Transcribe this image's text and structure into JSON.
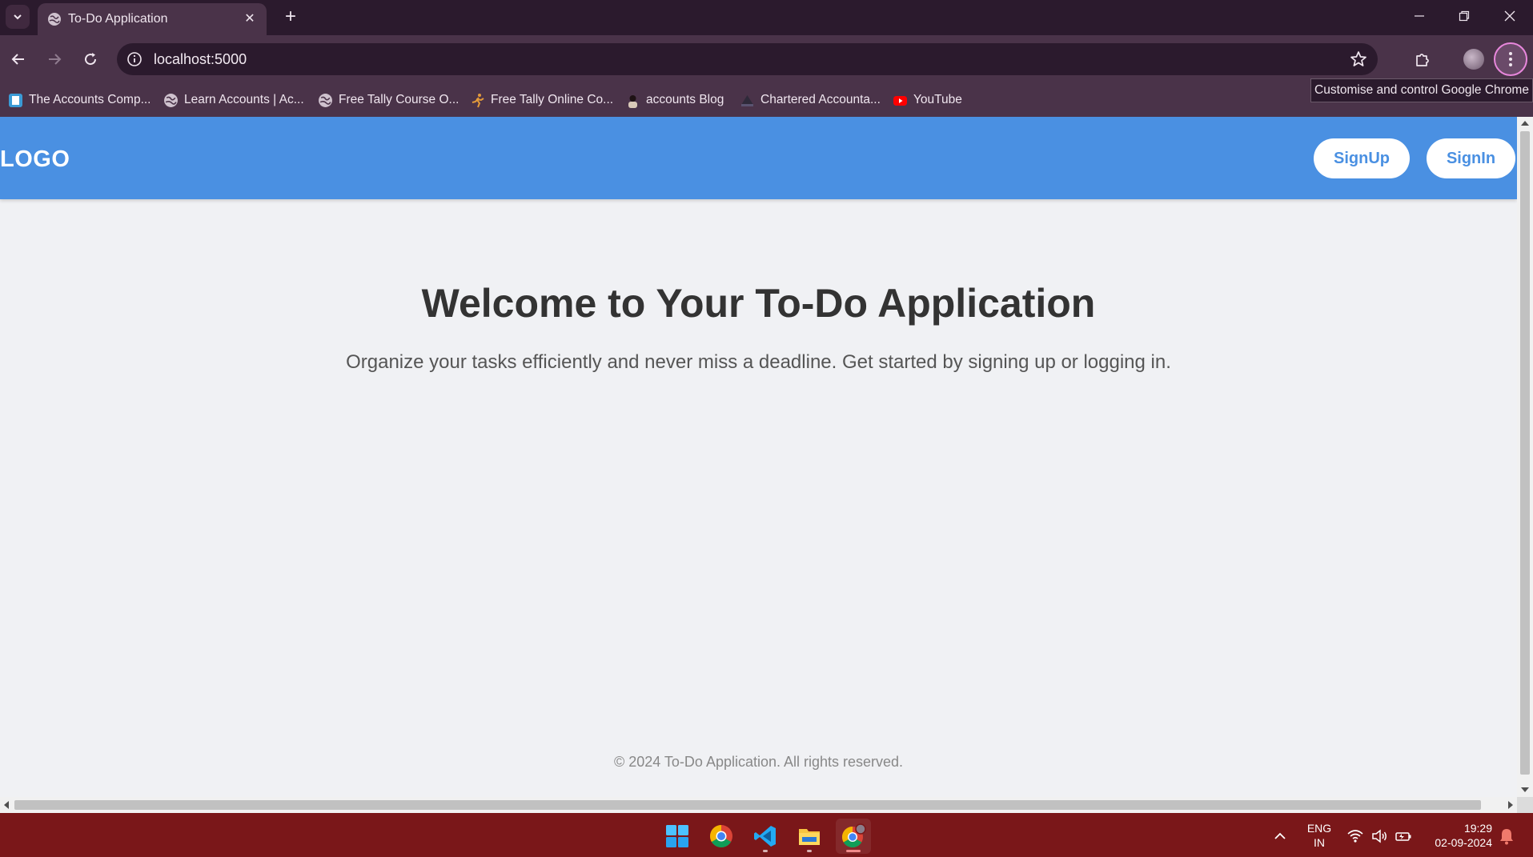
{
  "browser": {
    "tab_title": "To-Do Application",
    "url": "localhost:5000",
    "tooltip": "Customise and control Google Chrome",
    "bookmarks": [
      {
        "label": "The Accounts Comp...",
        "icon": "accounts-site-icon"
      },
      {
        "label": "Learn Accounts | Ac...",
        "icon": "globe-icon"
      },
      {
        "label": "Free Tally Course O...",
        "icon": "globe-icon"
      },
      {
        "label": "Free Tally Online Co...",
        "icon": "tally-runner-icon"
      },
      {
        "label": "accounts Blog",
        "icon": "blog-avatar-icon"
      },
      {
        "label": "Chartered Accounta...",
        "icon": "ca-site-icon"
      },
      {
        "label": "YouTube",
        "icon": "youtube-icon"
      }
    ]
  },
  "page": {
    "logo": "LOGO",
    "signup_label": "SignUp",
    "signin_label": "SignIn",
    "hero_title": "Welcome to Your To-Do Application",
    "hero_subtitle": "Organize your tasks efficiently and never miss a deadline. Get started by signing up or logging in.",
    "footer": "© 2024 To-Do Application. All rights reserved."
  },
  "taskbar": {
    "apps": [
      "windows-start-icon",
      "chrome-icon",
      "vscode-icon",
      "file-explorer-icon",
      "chrome-profile-icon"
    ],
    "language_line1": "ENG",
    "language_line2": "IN",
    "time": "19:29",
    "date": "02-09-2024"
  },
  "colors": {
    "navbar": "#4a90e2",
    "page_bg": "#f0f1f4",
    "taskbar": "#7a1719",
    "browser_frame": "#4a3349"
  }
}
